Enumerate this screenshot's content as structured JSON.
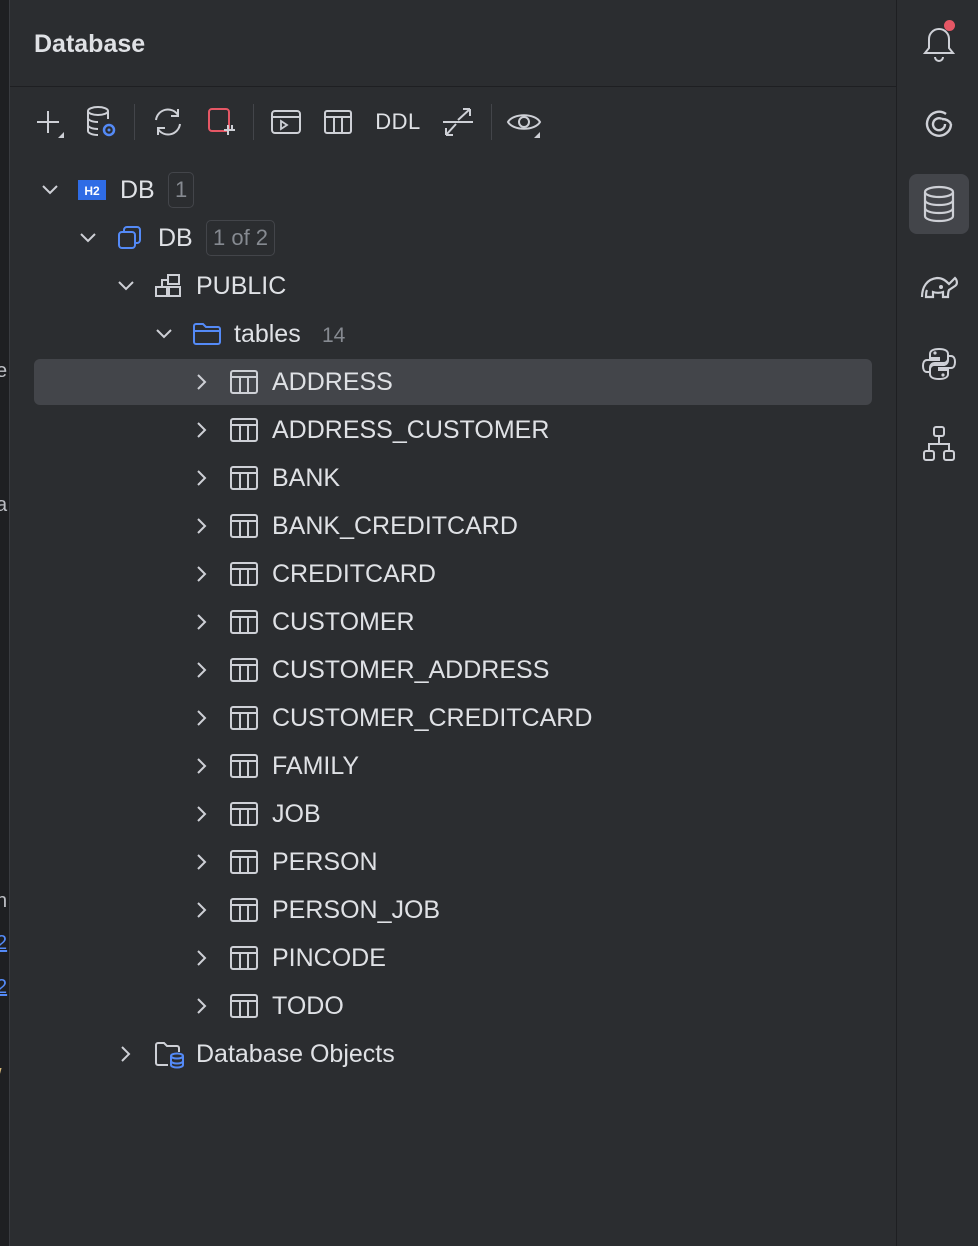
{
  "panel": {
    "title": "Database"
  },
  "toolbar": {
    "buttons": [
      {
        "name": "new-icon"
      },
      {
        "name": "data-source-properties-icon"
      },
      {
        "name": "refresh-icon"
      },
      {
        "name": "disconnect-icon"
      },
      {
        "name": "jump-to-query-console-icon"
      },
      {
        "name": "table-editor-icon"
      },
      {
        "name": "ddl",
        "label": "DDL"
      },
      {
        "name": "compare-icon"
      },
      {
        "name": "view-options-icon"
      }
    ]
  },
  "tree": {
    "datasource": {
      "label": "DB",
      "badge": "1",
      "icon": "h2-icon",
      "icon_text": "H2"
    },
    "database": {
      "label": "DB",
      "badge": "1 of 2"
    },
    "schema": {
      "label": "PUBLIC"
    },
    "tables_folder": {
      "label": "tables",
      "count": "14"
    },
    "tables": [
      "ADDRESS",
      "ADDRESS_CUSTOMER",
      "BANK",
      "BANK_CREDITCARD",
      "CREDITCARD",
      "CUSTOMER",
      "CUSTOMER_ADDRESS",
      "CUSTOMER_CREDITCARD",
      "FAMILY",
      "JOB",
      "PERSON",
      "PERSON_JOB",
      "PINCODE",
      "TODO"
    ],
    "selected_table": "ADDRESS",
    "db_objects": {
      "label": "Database Objects"
    }
  },
  "rail": {
    "buttons": [
      {
        "name": "notifications-icon"
      },
      {
        "name": "ai-assistant-icon"
      },
      {
        "name": "database-icon",
        "active": true
      },
      {
        "name": "gradle-icon"
      },
      {
        "name": "python-icon"
      },
      {
        "name": "structure-icon"
      }
    ]
  },
  "colors": {
    "background": "#2b2d30",
    "selection": "#43454a",
    "accent": "#548af7",
    "h2_badge": "#2f6ce5",
    "alert_red": "#e55765"
  }
}
